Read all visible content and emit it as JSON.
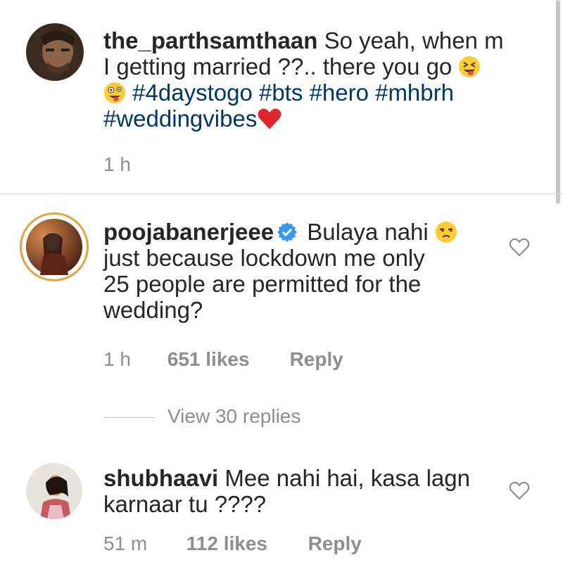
{
  "caption": {
    "username": "the_parthsamthaan",
    "text_part1": "So yeah, when m",
    "text_part2": "I getting married ??.. there you go",
    "hashtags_line1": "#4daystogo #bts #hero #mhbrh",
    "hashtags_line2": "#weddingvibes",
    "time": "1 h"
  },
  "comments": [
    {
      "username": "poojabanerjeee",
      "verified": true,
      "text_line1": "Bulaya nahi",
      "text_line2": "just because lockdown me only",
      "text_line3": "25 people are permitted for the",
      "text_line4": "wedding?",
      "time": "1 h",
      "likes": "651 likes",
      "reply": "Reply",
      "view_replies": "View 30 replies"
    },
    {
      "username": "shubhaavi",
      "text_line1": "Mee nahi hai, kasa lagn",
      "text_line2": "karnaar tu ????",
      "time": "51 m",
      "likes": "112 likes",
      "reply": "Reply"
    }
  ],
  "icons": {
    "heart": "heart-outline-icon",
    "verified": "verified-badge-icon",
    "emoji_squint": "squinting-tongue-emoji",
    "emoji_zany": "zany-face-emoji",
    "emoji_heart": "red-heart-emoji",
    "emoji_unamused": "unamused-face-emoji"
  },
  "colors": {
    "hashtag": "#00376b",
    "meta": "#8e8e8e",
    "verified": "#3897f0",
    "heart_emoji": "#e0252b"
  }
}
